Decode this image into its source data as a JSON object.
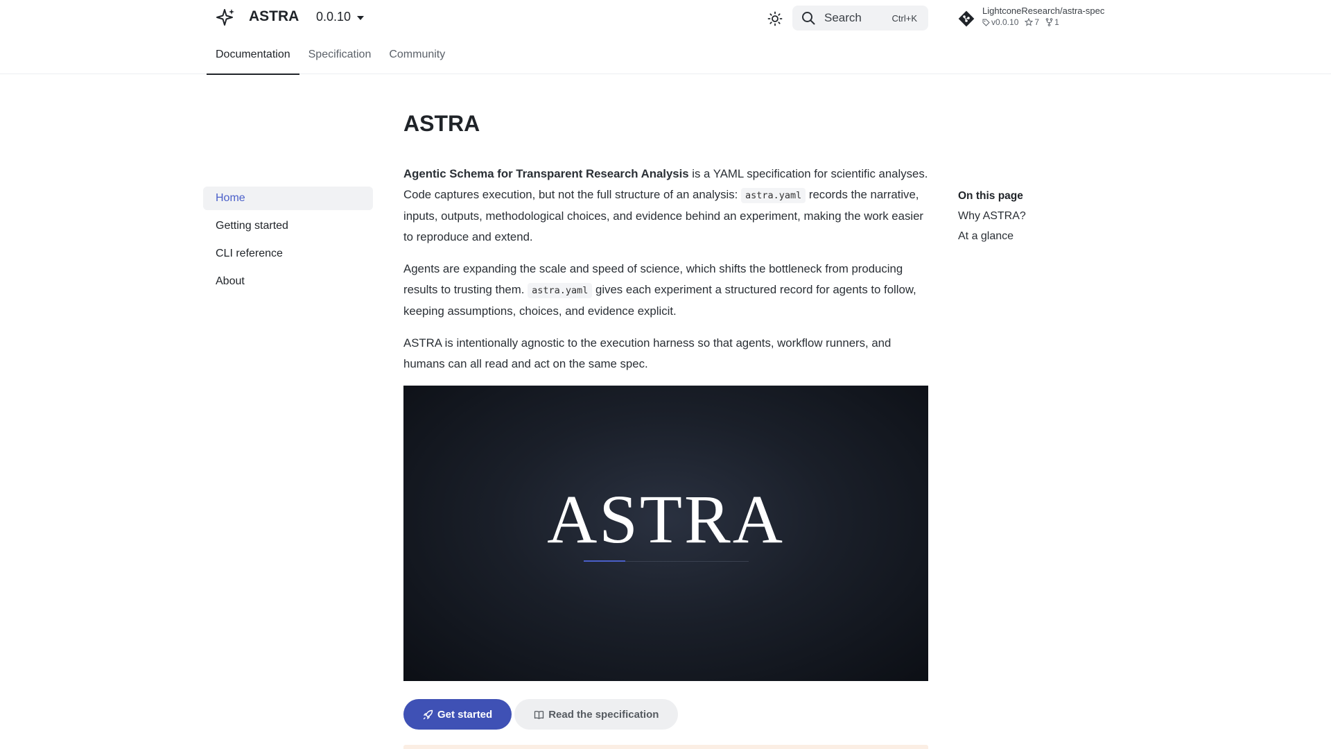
{
  "header": {
    "site_title": "ASTRA",
    "version": "0.0.10",
    "search_label": "Search",
    "search_shortcut": "Ctrl+K",
    "repo": {
      "name": "LightconeResearch/astra-spec",
      "tag": "v0.0.10",
      "stars": "7",
      "forks": "1"
    }
  },
  "tabs": [
    {
      "label": "Documentation",
      "active": true
    },
    {
      "label": "Specification",
      "active": false
    },
    {
      "label": "Community",
      "active": false
    }
  ],
  "sidebar": {
    "items": [
      {
        "label": "Home",
        "active": true
      },
      {
        "label": "Getting started",
        "active": false
      },
      {
        "label": "CLI reference",
        "active": false
      },
      {
        "label": "About",
        "active": false
      }
    ]
  },
  "content": {
    "title": "ASTRA",
    "p1": {
      "strong": "Agentic Schema for Transparent Research Analysis",
      "t1": " is a YAML specification for scientific analyses. Code captures execution, but not the full structure of an analysis: ",
      "code": "astra.yaml",
      "t2": " records the narrative, inputs, outputs, methodological choices, and evidence behind an experiment, making the work easier to reproduce and extend."
    },
    "p2": {
      "t1": "Agents are expanding the scale and speed of science, which shifts the bottleneck from producing results to trusting them. ",
      "code": "astra.yaml",
      "t2": " gives each experiment a structured record for agents to follow, keeping assumptions, choices, and evidence explicit."
    },
    "p3": "ASTRA is intentionally agnostic to the execution harness so that agents, workflow runners, and humans can all read and act on the same spec.",
    "hero_text": "ASTRA",
    "buttons": {
      "primary": "Get started",
      "secondary": "Read the specification"
    }
  },
  "toc": {
    "title": "On this page",
    "items": [
      "Why ASTRA?",
      "At a glance"
    ]
  },
  "colors": {
    "accent": "#3f51b5",
    "sidebar_active_text": "#4a5fc9",
    "hero_bg": "#1a1f29"
  },
  "icons": {
    "logo": "sparkle-icon",
    "theme": "sun-icon",
    "search": "search-icon",
    "repo": "git-icon",
    "tag": "tag-icon",
    "star": "star-icon",
    "fork": "fork-icon",
    "rocket": "rocket-icon",
    "book": "book-icon"
  }
}
